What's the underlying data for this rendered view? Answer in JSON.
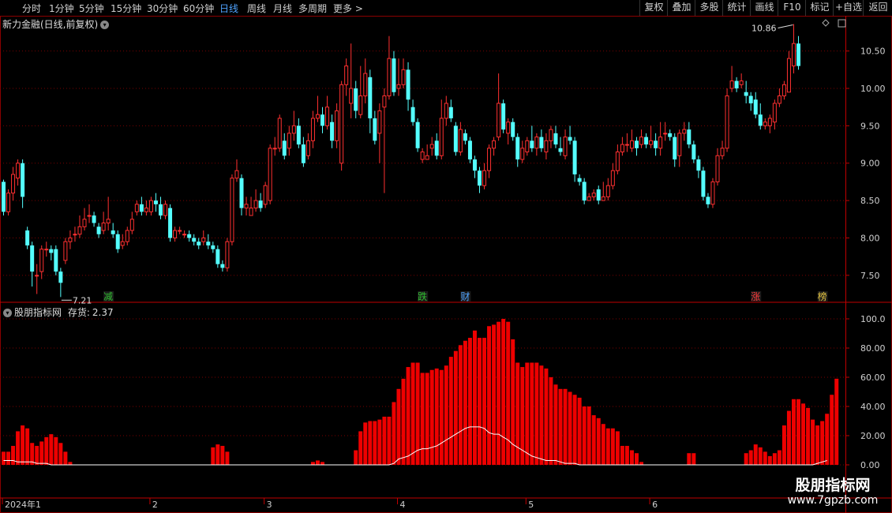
{
  "toolbar": {
    "periods": [
      "分时",
      "1分钟",
      "5分钟",
      "15分钟",
      "30分钟",
      "60分钟",
      "日线",
      "周线",
      "月线",
      "多周期",
      "更多 >"
    ],
    "active_period": "日线",
    "right_buttons": [
      "复权",
      "叠加",
      "多股",
      "统计",
      "画线",
      "F10",
      "标记",
      "+自选",
      "返回"
    ]
  },
  "main_panel": {
    "title": "新力金融(日线,前复权)",
    "title_icon": "chevron-down-icon",
    "high_label": "10.86",
    "low_label": "7.21",
    "price_ticks": [
      "10.50",
      "10.00",
      "9.50",
      "9.00",
      "8.50",
      "8.00",
      "7.50"
    ],
    "markers": [
      {
        "text": "减",
        "color": "#2fbf2f"
      },
      {
        "text": "跌",
        "color": "#2fbf2f"
      },
      {
        "text": "财",
        "color": "#4fa3ff"
      },
      {
        "text": "涨",
        "color": "#ff3b3b"
      },
      {
        "text": "榜",
        "color": "#e0c040"
      }
    ]
  },
  "sub_panel": {
    "title": "股朋指标网",
    "indicator_label": "存货:",
    "indicator_value": "2.37",
    "ticks": [
      "100.0",
      "80.00",
      "60.00",
      "40.00",
      "20.00",
      "0.00"
    ]
  },
  "x_axis": {
    "labels": [
      "2024年1",
      "2",
      "3",
      "4",
      "5",
      "6"
    ]
  },
  "watermark": {
    "line1": "股朋指标网",
    "line2": "www.7gpzb.com"
  },
  "colors": {
    "up": "#ff3030",
    "down": "#54ffff",
    "bar": "#ee0000",
    "grid": "#7a0000",
    "tick": "#d0d0d0"
  },
  "chart_data": {
    "type": "candlestick+bar",
    "candles": [
      [
        8.75,
        8.35,
        8.78,
        8.3
      ],
      [
        8.35,
        8.6,
        8.65,
        8.3
      ],
      [
        8.6,
        8.85,
        8.95,
        8.5
      ],
      [
        8.8,
        9.0,
        9.05,
        8.7
      ],
      [
        9.0,
        8.55,
        9.05,
        8.4
      ],
      [
        8.1,
        7.9,
        8.15,
        7.85
      ],
      [
        7.9,
        7.55,
        7.95,
        7.35
      ],
      [
        7.5,
        7.5,
        7.65,
        7.25
      ],
      [
        7.55,
        7.85,
        7.9,
        7.45
      ],
      [
        7.85,
        7.85,
        7.95,
        7.75
      ],
      [
        7.85,
        7.8,
        7.9,
        7.7
      ],
      [
        7.85,
        7.55,
        7.9,
        7.5
      ],
      [
        7.55,
        7.4,
        7.6,
        7.21
      ],
      [
        7.7,
        7.95,
        8.0,
        7.65
      ],
      [
        7.95,
        8.0,
        8.1,
        7.85
      ],
      [
        8.05,
        8.05,
        8.15,
        7.95
      ],
      [
        8.05,
        8.15,
        8.3,
        8.0
      ],
      [
        8.15,
        8.25,
        8.4,
        8.1
      ],
      [
        8.3,
        8.3,
        8.45,
        8.2
      ],
      [
        8.3,
        8.2,
        8.35,
        8.15
      ],
      [
        8.15,
        8.05,
        8.2,
        8.0
      ],
      [
        8.1,
        8.2,
        8.35,
        8.05
      ],
      [
        8.2,
        8.25,
        8.55,
        8.1
      ],
      [
        8.1,
        8.05,
        8.2,
        8.0
      ],
      [
        8.05,
        7.85,
        8.1,
        7.8
      ],
      [
        7.9,
        7.95,
        8.05,
        7.85
      ],
      [
        7.95,
        8.1,
        8.15,
        7.9
      ],
      [
        8.1,
        8.25,
        8.35,
        8.05
      ],
      [
        8.35,
        8.45,
        8.5,
        8.3
      ],
      [
        8.45,
        8.35,
        8.55,
        8.3
      ],
      [
        8.35,
        8.4,
        8.5,
        8.3
      ],
      [
        8.35,
        8.5,
        8.55,
        8.3
      ],
      [
        8.5,
        8.45,
        8.6,
        8.35
      ],
      [
        8.45,
        8.3,
        8.55,
        8.25
      ],
      [
        8.3,
        8.45,
        8.5,
        8.25
      ],
      [
        8.4,
        8.0,
        8.45,
        7.95
      ],
      [
        8.0,
        8.1,
        8.15,
        7.95
      ],
      [
        8.1,
        8.1,
        8.15,
        8.05
      ],
      [
        8.05,
        8.05,
        8.1,
        8.0
      ],
      [
        8.05,
        8.0,
        8.1,
        7.95
      ],
      [
        8.0,
        7.95,
        8.05,
        7.9
      ],
      [
        7.95,
        7.9,
        8.0,
        7.85
      ],
      [
        7.95,
        8.0,
        8.1,
        7.9
      ],
      [
        7.95,
        7.9,
        8.05,
        7.85
      ],
      [
        7.9,
        7.85,
        7.95,
        7.8
      ],
      [
        7.85,
        7.65,
        7.9,
        7.6
      ],
      [
        7.65,
        7.6,
        7.7,
        7.55
      ],
      [
        7.6,
        7.95,
        8.0,
        7.55
      ],
      [
        7.95,
        8.8,
        8.85,
        7.9
      ],
      [
        8.8,
        8.9,
        9.05,
        8.75
      ],
      [
        8.8,
        8.4,
        8.85,
        8.3
      ],
      [
        8.4,
        8.45,
        8.55,
        8.3
      ],
      [
        8.3,
        8.4,
        8.55,
        8.3
      ],
      [
        8.4,
        8.5,
        8.65,
        8.35
      ],
      [
        8.5,
        8.4,
        8.6,
        8.35
      ],
      [
        8.45,
        8.7,
        8.75,
        8.4
      ],
      [
        8.5,
        9.2,
        9.25,
        8.45
      ],
      [
        9.2,
        9.2,
        9.35,
        9.1
      ],
      [
        9.2,
        9.6,
        9.65,
        9.15
      ],
      [
        9.3,
        9.1,
        9.4,
        9.05
      ],
      [
        9.2,
        9.4,
        9.5,
        9.1
      ],
      [
        9.4,
        9.5,
        9.7,
        9.3
      ],
      [
        9.5,
        9.25,
        9.6,
        9.2
      ],
      [
        9.25,
        9.0,
        9.35,
        8.95
      ],
      [
        9.1,
        9.3,
        9.4,
        9.05
      ],
      [
        9.3,
        9.6,
        9.7,
        9.2
      ],
      [
        9.6,
        9.65,
        9.9,
        9.55
      ],
      [
        9.65,
        9.5,
        9.75,
        9.4
      ],
      [
        9.5,
        9.75,
        9.9,
        9.45
      ],
      [
        9.55,
        9.3,
        9.65,
        9.2
      ],
      [
        9.3,
        9.7,
        9.8,
        9.2
      ],
      [
        9.0,
        10.05,
        10.1,
        8.9
      ],
      [
        10.05,
        10.3,
        10.4,
        9.9
      ],
      [
        9.8,
        10.0,
        10.6,
        9.6
      ],
      [
        10.0,
        9.7,
        10.1,
        9.6
      ],
      [
        9.65,
        9.9,
        10.3,
        9.6
      ],
      [
        9.9,
        10.2,
        10.4,
        9.8
      ],
      [
        10.15,
        9.6,
        10.25,
        9.4
      ],
      [
        9.6,
        9.3,
        9.7,
        9.25
      ],
      [
        9.4,
        9.7,
        9.8,
        9.0
      ],
      [
        9.75,
        9.9,
        10.0,
        8.6
      ],
      [
        9.9,
        10.4,
        10.7,
        9.85
      ],
      [
        10.4,
        9.95,
        10.5,
        9.9
      ],
      [
        10.0,
        10.05,
        10.4,
        9.9
      ],
      [
        10.05,
        10.25,
        10.4,
        10.0
      ],
      [
        10.25,
        9.85,
        10.35,
        9.7
      ],
      [
        9.75,
        9.55,
        9.85,
        9.5
      ],
      [
        9.55,
        9.2,
        9.6,
        9.15
      ],
      [
        9.05,
        9.15,
        9.2,
        9.0
      ],
      [
        9.05,
        9.1,
        9.25,
        9.05
      ],
      [
        9.2,
        9.25,
        9.35,
        9.1
      ],
      [
        9.3,
        9.1,
        9.4,
        9.05
      ],
      [
        9.1,
        9.6,
        9.85,
        9.05
      ],
      [
        9.6,
        9.8,
        9.9,
        9.5
      ],
      [
        9.75,
        9.6,
        9.85,
        9.55
      ],
      [
        9.5,
        9.15,
        9.55,
        9.1
      ],
      [
        9.15,
        9.45,
        9.55,
        9.1
      ],
      [
        9.4,
        9.3,
        9.45,
        9.25
      ],
      [
        9.3,
        9.05,
        9.35,
        9.0
      ],
      [
        9.05,
        8.9,
        9.1,
        8.8
      ],
      [
        8.9,
        8.7,
        8.95,
        8.6
      ],
      [
        8.7,
        8.9,
        9.0,
        8.65
      ],
      [
        8.9,
        9.2,
        9.25,
        8.8
      ],
      [
        9.2,
        9.3,
        9.35,
        9.1
      ],
      [
        9.35,
        9.8,
        10.2,
        9.3
      ],
      [
        9.8,
        9.45,
        9.85,
        9.4
      ],
      [
        9.4,
        9.55,
        9.6,
        9.25
      ],
      [
        9.55,
        9.35,
        9.6,
        9.3
      ],
      [
        9.35,
        9.05,
        9.4,
        8.95
      ],
      [
        9.05,
        9.2,
        9.3,
        9.0
      ],
      [
        9.15,
        9.3,
        9.35,
        9.1
      ],
      [
        9.3,
        9.2,
        9.5,
        9.15
      ],
      [
        9.2,
        9.35,
        9.4,
        9.1
      ],
      [
        9.35,
        9.2,
        9.45,
        9.15
      ],
      [
        9.15,
        9.3,
        9.4,
        9.05
      ],
      [
        9.3,
        9.45,
        9.5,
        9.2
      ],
      [
        9.4,
        9.25,
        9.5,
        9.2
      ],
      [
        9.2,
        9.15,
        9.35,
        9.1
      ],
      [
        9.1,
        9.35,
        9.45,
        9.05
      ],
      [
        9.35,
        9.3,
        9.5,
        9.25
      ],
      [
        9.3,
        8.85,
        9.35,
        8.75
      ],
      [
        8.8,
        8.75,
        8.85,
        8.7
      ],
      [
        8.75,
        8.5,
        8.8,
        8.45
      ],
      [
        8.5,
        8.55,
        8.6,
        8.5
      ],
      [
        8.55,
        8.6,
        8.65,
        8.5
      ],
      [
        8.65,
        8.5,
        8.7,
        8.45
      ],
      [
        8.5,
        8.55,
        8.75,
        8.5
      ],
      [
        8.55,
        8.7,
        8.8,
        8.5
      ],
      [
        8.7,
        8.9,
        9.0,
        8.65
      ],
      [
        8.9,
        9.15,
        9.25,
        8.85
      ],
      [
        9.15,
        9.25,
        9.35,
        9.1
      ],
      [
        9.25,
        9.25,
        9.4,
        9.15
      ],
      [
        9.2,
        9.3,
        9.45,
        9.15
      ],
      [
        9.3,
        9.2,
        9.35,
        9.1
      ],
      [
        9.25,
        9.35,
        9.45,
        9.2
      ],
      [
        9.35,
        9.25,
        9.4,
        9.2
      ],
      [
        9.25,
        9.3,
        9.5,
        9.2
      ],
      [
        9.3,
        9.2,
        9.4,
        9.1
      ],
      [
        9.2,
        9.35,
        9.55,
        9.1
      ],
      [
        9.4,
        9.4,
        9.55,
        9.3
      ],
      [
        9.4,
        9.35,
        9.45,
        9.3
      ],
      [
        9.35,
        9.05,
        9.4,
        8.95
      ],
      [
        9.1,
        9.4,
        9.45,
        8.95
      ],
      [
        9.4,
        9.45,
        9.55,
        9.3
      ],
      [
        9.45,
        9.25,
        9.55,
        9.2
      ],
      [
        9.25,
        9.05,
        9.3,
        9.0
      ],
      [
        9.05,
        8.9,
        9.1,
        8.8
      ],
      [
        8.9,
        8.55,
        8.95,
        8.5
      ],
      [
        8.55,
        8.45,
        8.6,
        8.4
      ],
      [
        8.45,
        8.75,
        8.8,
        8.4
      ],
      [
        8.75,
        9.1,
        9.2,
        8.7
      ],
      [
        9.1,
        9.2,
        9.3,
        9.05
      ],
      [
        9.2,
        9.9,
        10.0,
        9.15
      ],
      [
        10.0,
        10.1,
        10.3,
        9.95
      ],
      [
        10.1,
        10.0,
        10.15,
        9.95
      ],
      [
        10.05,
        10.1,
        10.2,
        10.0
      ],
      [
        9.95,
        9.9,
        10.1,
        9.8
      ],
      [
        9.9,
        9.8,
        9.95,
        9.7
      ],
      [
        9.85,
        9.65,
        9.95,
        9.6
      ],
      [
        9.65,
        9.5,
        9.8,
        9.45
      ],
      [
        9.5,
        9.55,
        9.6,
        9.45
      ],
      [
        9.5,
        9.6,
        9.65,
        9.4
      ],
      [
        9.55,
        9.8,
        9.85,
        9.45
      ],
      [
        9.8,
        9.9,
        10.0,
        9.75
      ],
      [
        9.9,
        10.05,
        10.1,
        9.85
      ],
      [
        9.95,
        10.4,
        10.5,
        9.95
      ],
      [
        10.3,
        10.6,
        10.86,
        10.2
      ],
      [
        10.6,
        10.3,
        10.7,
        10.25
      ]
    ],
    "bars": [
      9,
      9,
      13,
      23,
      27,
      25,
      15,
      13,
      16,
      19,
      21,
      19,
      15,
      9,
      2,
      0,
      0,
      0,
      0,
      0,
      0,
      0,
      0,
      0,
      0,
      0,
      0,
      0,
      0,
      0,
      0,
      0,
      0,
      0,
      0,
      0,
      0,
      0,
      0,
      0,
      0,
      0,
      0,
      0,
      12,
      14,
      13,
      9,
      0,
      0,
      0,
      0,
      0,
      0,
      0,
      0,
      0,
      0,
      0,
      0,
      0,
      0,
      0,
      0,
      0,
      2,
      3,
      2,
      0,
      0,
      0,
      0,
      0,
      0,
      10,
      23,
      29,
      30,
      30,
      31,
      33,
      33,
      43,
      52,
      59,
      67,
      70,
      70,
      63,
      63,
      65,
      66,
      65,
      68,
      74,
      78,
      82,
      85,
      87,
      92,
      87,
      87,
      95,
      96,
      98,
      100,
      98,
      86,
      70,
      67,
      70,
      70,
      70,
      68,
      66,
      60,
      55,
      52,
      52,
      50,
      48,
      46,
      40,
      40,
      34,
      32,
      28,
      25,
      25,
      23,
      13,
      13,
      10,
      8,
      2,
      0,
      0,
      0,
      0,
      0,
      0,
      0,
      0,
      0,
      8,
      8,
      0,
      0,
      0,
      0,
      0,
      0,
      0,
      0,
      0,
      0,
      8,
      10,
      14,
      12,
      9,
      6,
      8,
      10,
      27,
      37,
      45,
      45,
      42,
      39,
      31,
      27,
      30,
      35,
      48,
      59
    ],
    "line": [
      3,
      3,
      3,
      2,
      2,
      2,
      2,
      1,
      1,
      1,
      0,
      0,
      0,
      0,
      0,
      0,
      0,
      0,
      0,
      0,
      0,
      0,
      0,
      0,
      0,
      0,
      0,
      0,
      0,
      0,
      0,
      0,
      0,
      0,
      0,
      0,
      0,
      0,
      0,
      0,
      0,
      0,
      0,
      0,
      0,
      0,
      0,
      0,
      0,
      0,
      0,
      0,
      0,
      0,
      0,
      0,
      0,
      0,
      0,
      0,
      0,
      0,
      0,
      0,
      0,
      0,
      0,
      0,
      0,
      0,
      0,
      0,
      0,
      0,
      0,
      0,
      0,
      0,
      0,
      0,
      0,
      0,
      1,
      4,
      5,
      6,
      8,
      10,
      11,
      11,
      12,
      13,
      15,
      17,
      19,
      21,
      23,
      25,
      26,
      26,
      26,
      25,
      22,
      21,
      21,
      19,
      17,
      14,
      12,
      10,
      8,
      6,
      5,
      4,
      3,
      3,
      3,
      2,
      1,
      1,
      1,
      0,
      0,
      0,
      0,
      0,
      0,
      0,
      0,
      0,
      0,
      0,
      0,
      0,
      0,
      0,
      0,
      0,
      0,
      0,
      0,
      0,
      0,
      0,
      0,
      0,
      0,
      0,
      0,
      0,
      0,
      0,
      0,
      0,
      0,
      0,
      0,
      0,
      0,
      0,
      0,
      0,
      0,
      0,
      0,
      0,
      0,
      0,
      0,
      0,
      0,
      1,
      2,
      3
    ],
    "main_ylim": [
      7.15,
      10.95
    ],
    "sub_ylim": [
      0,
      100
    ],
    "marker_indexes": [
      22,
      88,
      97,
      158,
      172
    ],
    "month_start_indexes": [
      0,
      31,
      55,
      83,
      110,
      136
    ]
  }
}
